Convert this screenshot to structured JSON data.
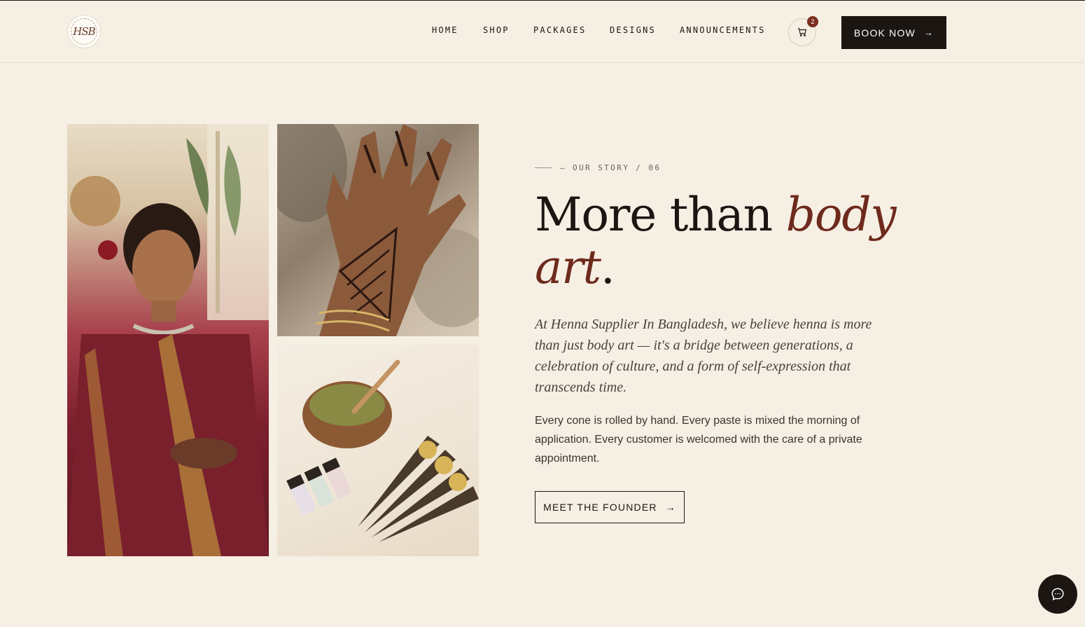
{
  "header": {
    "logo_text": "HSB",
    "nav": [
      {
        "label": "HOME"
      },
      {
        "label": "SHOP"
      },
      {
        "label": "PACKAGES"
      },
      {
        "label": "DESIGNS"
      },
      {
        "label": "ANNOUNCEMENTS"
      }
    ],
    "cart_count": "2",
    "book_label": "BOOK NOW",
    "book_arrow": "→"
  },
  "story": {
    "eyebrow": "— OUR STORY / 06",
    "headline_plain": "More than ",
    "headline_em_1": "body",
    "headline_em_2": "art",
    "headline_end": ".",
    "lead": "At Henna Supplier In Bangladesh, we believe henna is more than just body art — it's a bridge between generations, a celebration of culture, and a form of self-expression that transcends time.",
    "body": "Every cone is rolled by hand. Every paste is mixed the morning of application. Every customer is welcomed with the care of a private appointment.",
    "cta_label": "MEET THE FOUNDER",
    "cta_arrow": "→"
  },
  "colors": {
    "background": "#f6efe4",
    "ink": "#1c1613",
    "accent": "#6e2a1c",
    "badge": "#7a2e1f"
  },
  "icons": {
    "cart": "cart-icon",
    "chat": "chat-icon",
    "arrow": "arrow-right-icon"
  }
}
